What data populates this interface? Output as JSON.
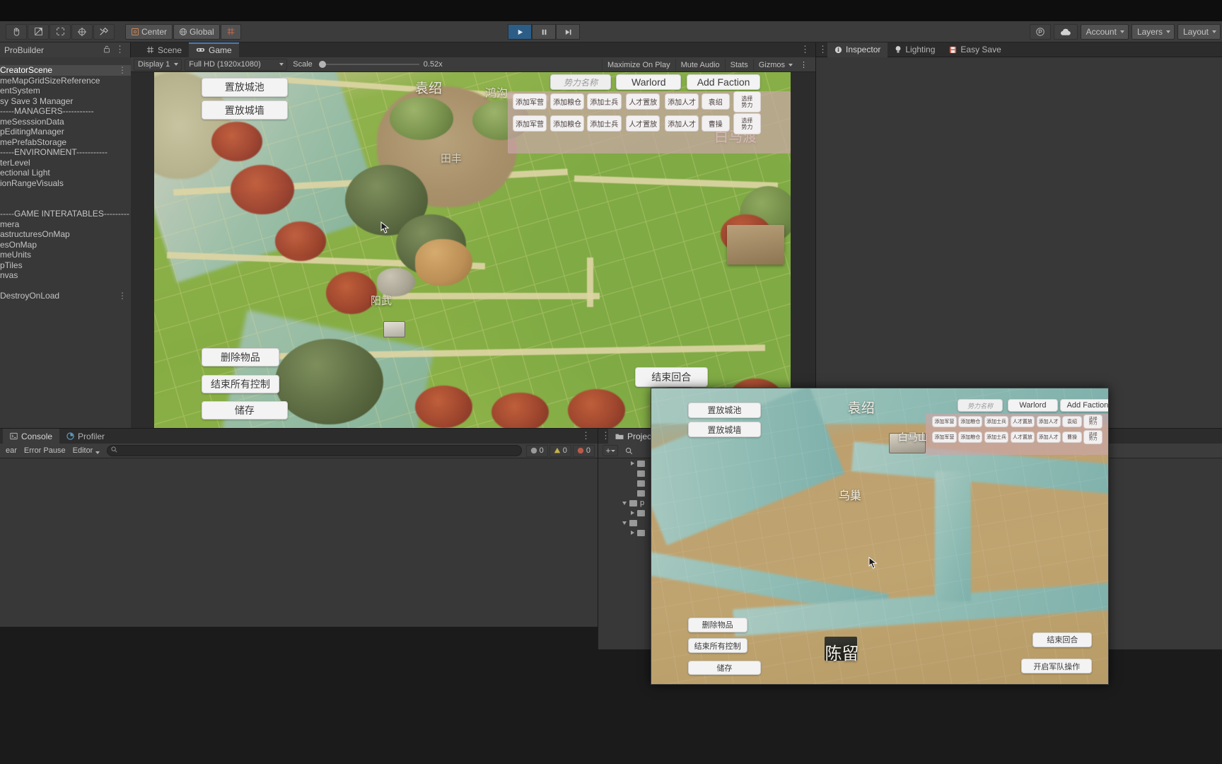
{
  "app": {
    "title": "Unity Editor",
    "theme_bg": "#383838",
    "accent": "#2c5d87"
  },
  "toolbar": {
    "tools": [
      {
        "name": "hand-tool",
        "glyph": "✋"
      },
      {
        "name": "move-tool",
        "glyph": "✥"
      },
      {
        "name": "rotate-tool",
        "glyph": "⟳"
      },
      {
        "name": "scale-tool",
        "glyph": "⤡"
      },
      {
        "name": "rect-tool",
        "glyph": "⬚"
      },
      {
        "name": "transform-tool",
        "glyph": "⊕"
      },
      {
        "name": "custom-tool",
        "glyph": "⚒"
      }
    ],
    "pivot_label": "Center",
    "handle_label": "Global",
    "grid_label": "#",
    "play_label": "▶",
    "pause_label": "‖",
    "step_label": "▶|",
    "cloud_label": "☁",
    "collab_label": "Ⓟ",
    "account_label": "Account",
    "layers_label": "Layers",
    "layout_label": "Layout"
  },
  "probuilder": {
    "tab_label": "ProBuilder",
    "lock_glyph": "␣",
    "menu_glyph": "⋮"
  },
  "hierarchy": {
    "items": [
      {
        "label": "CreatorScene",
        "selected": true,
        "more": "⋮"
      },
      {
        "label": "meMapGridSizeReference",
        "selected": false
      },
      {
        "label": "entSystem",
        "selected": false
      },
      {
        "label": "sy Save 3 Manager",
        "selected": false
      },
      {
        "label": "-----MANAGERS-----------",
        "selected": false
      },
      {
        "label": "meSesssionData",
        "selected": false
      },
      {
        "label": "pEditingManager",
        "selected": false
      },
      {
        "label": "mePrefabStorage",
        "selected": false
      },
      {
        "label": "-----ENVIRONMENT-----------",
        "selected": false
      },
      {
        "label": "terLevel",
        "selected": false
      },
      {
        "label": "ectional Light",
        "selected": false
      },
      {
        "label": "ionRangeVisuals",
        "selected": false
      },
      {
        "label": "",
        "selected": false
      },
      {
        "label": "",
        "selected": false
      },
      {
        "label": "-----GAME INTERATABLES---------",
        "selected": false
      },
      {
        "label": "mera",
        "selected": false
      },
      {
        "label": "astructuresOnMap",
        "selected": false
      },
      {
        "label": "esOnMap",
        "selected": false
      },
      {
        "label": "meUnits",
        "selected": false
      },
      {
        "label": "pTiles",
        "selected": false
      },
      {
        "label": "nvas",
        "selected": false
      },
      {
        "label": "",
        "selected": false
      },
      {
        "label": "DestroyOnLoad",
        "selected": false,
        "more": "⋮"
      }
    ]
  },
  "gameview": {
    "tabs": [
      {
        "label": "Scene",
        "icon": "grid-icon",
        "selected": false
      },
      {
        "label": "Game",
        "icon": "gamepad-icon",
        "selected": true
      }
    ],
    "menu_glyph": "⋮",
    "display_label": "Display 1",
    "resolution_label": "Full HD (1920x1080)",
    "scale_label": "Scale",
    "scale_value": "0.52x",
    "maximize_label": "Maximize On Play",
    "mute_label": "Mute Audio",
    "stats_label": "Stats",
    "gizmos_label": "Gizmos"
  },
  "game_ui": {
    "left_buttons": [
      {
        "label": "置放城池",
        "name": "place-city-button"
      },
      {
        "label": "置放城墙",
        "name": "place-wall-button"
      }
    ],
    "bottom_left_buttons": [
      {
        "label": "删除物品",
        "name": "delete-item-button"
      },
      {
        "label": "结束所有控制",
        "name": "end-all-control-button"
      },
      {
        "label": "储存",
        "name": "save-button"
      }
    ],
    "end_turn_label": "结束回合",
    "faction_name_placeholder": "势力名称",
    "warlord_label": "Warlord",
    "add_faction_label": "Add Faction",
    "faction_rows": [
      {
        "buttons": [
          "添加军营",
          "添加粮仓",
          "添加士兵",
          "人才置放",
          "添加人才"
        ],
        "tag": "袁绍",
        "select_label": "选择\n势力"
      },
      {
        "buttons": [
          "添加军营",
          "添加粮仓",
          "添加士兵",
          "人才置放",
          "添加人才"
        ],
        "tag": "曹操",
        "select_label": "选择\n势力"
      }
    ],
    "map_labels": [
      {
        "text": "袁绍",
        "name": "map-label-yuanshao"
      },
      {
        "text": "鸿沟",
        "name": "map-label-honggou"
      },
      {
        "text": "白马渡",
        "name": "map-label-baimadu"
      },
      {
        "text": "田丰",
        "name": "map-label-tianfeng"
      },
      {
        "text": "阳武",
        "name": "map-label-yangwu"
      }
    ]
  },
  "inspector": {
    "tabs": [
      {
        "label": "Inspector",
        "icon": "info-icon",
        "selected": true
      },
      {
        "label": "Lighting",
        "icon": "bulb-icon",
        "selected": false
      },
      {
        "label": "Easy Save",
        "icon": "save-icon",
        "selected": false
      }
    ],
    "menu_glyph": "⋮"
  },
  "console": {
    "tabs": [
      {
        "label": "Console",
        "icon": "console-icon",
        "selected": true
      },
      {
        "label": "Profiler",
        "icon": "profiler-icon",
        "selected": false
      }
    ],
    "menu_glyph": "⋮",
    "clear_label": "ear",
    "error_pause_label": "Error Pause",
    "editor_label": "Editor",
    "search_placeholder": "",
    "counts": [
      {
        "icon": "info-icon",
        "value": "0"
      },
      {
        "icon": "warning-icon",
        "value": "0"
      },
      {
        "icon": "error-icon",
        "value": "0"
      }
    ]
  },
  "project": {
    "tabs": [
      {
        "label": "Project",
        "icon": "folder-icon",
        "selected": true
      }
    ],
    "menu_glyph": "⋮",
    "add_label": "+",
    "search_glyph": "⌕",
    "tree": [
      {
        "indent": 1,
        "arrow": "right",
        "icon": "folder-icon",
        "label": ""
      },
      {
        "indent": 1,
        "arrow": "none",
        "icon": "file-icon",
        "label": ""
      },
      {
        "indent": 1,
        "arrow": "none",
        "icon": "file-icon",
        "label": ""
      },
      {
        "indent": 1,
        "arrow": "none",
        "icon": "file-icon",
        "label": ""
      },
      {
        "indent": 0,
        "arrow": "down",
        "icon": "folder-icon",
        "label": "p"
      },
      {
        "indent": 1,
        "arrow": "right",
        "icon": "folder-icon",
        "label": ""
      },
      {
        "indent": 0,
        "arrow": "down",
        "icon": "folder-icon",
        "label": ""
      },
      {
        "indent": 1,
        "arrow": "right",
        "icon": "folder-icon",
        "label": ""
      }
    ]
  },
  "float_window": {
    "left_buttons": [
      {
        "label": "置放城池",
        "name": "fw-place-city-button"
      },
      {
        "label": "置放城墙",
        "name": "fw-place-wall-button"
      }
    ],
    "bottom_left_buttons": [
      {
        "label": "删除物品",
        "name": "fw-delete-item-button"
      },
      {
        "label": "结束所有控制",
        "name": "fw-end-all-control-button"
      },
      {
        "label": "储存",
        "name": "fw-save-button"
      }
    ],
    "bottom_right_buttons": [
      {
        "label": "结束回合",
        "name": "fw-end-turn-button"
      },
      {
        "label": "开启军队操作",
        "name": "fw-open-army-ops-button"
      }
    ],
    "faction_name_placeholder": "势力名称",
    "warlord_label": "Warlord",
    "add_faction_label": "Add Faction",
    "faction_rows": [
      {
        "buttons": [
          "添加军营",
          "添加粮仓",
          "添加士兵",
          "人才置放",
          "添加人才"
        ],
        "tag": "袁绍"
      },
      {
        "buttons": [
          "添加军营",
          "添加粮仓",
          "添加士兵",
          "人才置放",
          "添加人才"
        ],
        "tag": "曹操"
      }
    ],
    "map_labels": [
      {
        "text": "袁绍",
        "name": "fw-map-label-yuanshao",
        "size": 19
      },
      {
        "text": "白马山",
        "name": "fw-map-label-baimashan",
        "size": 14
      },
      {
        "text": "乌巢",
        "name": "fw-map-label-wuchao",
        "size": 16
      },
      {
        "text": "陈留",
        "name": "fw-map-label-chenliu",
        "size": 24
      }
    ]
  }
}
